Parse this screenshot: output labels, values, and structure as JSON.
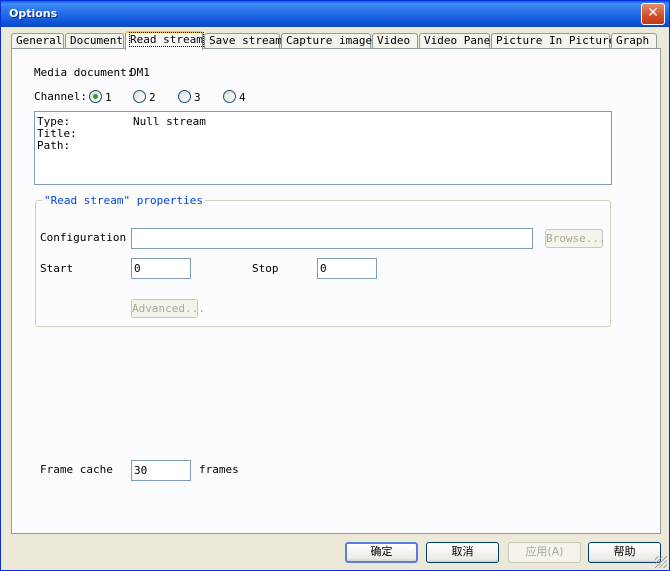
{
  "window": {
    "title": "Options",
    "close_label": "✕"
  },
  "tabs": [
    {
      "label": "General"
    },
    {
      "label": "Document"
    },
    {
      "label": "Read stream",
      "active": true
    },
    {
      "label": "Save stream"
    },
    {
      "label": "Capture image"
    },
    {
      "label": "Video"
    },
    {
      "label": "Video Pane"
    },
    {
      "label": "Picture In Picture"
    },
    {
      "label": "Graph"
    }
  ],
  "media": {
    "label": "Media document:",
    "value": "DM1"
  },
  "channel": {
    "label": "Channel:",
    "options": [
      "1",
      "2",
      "3",
      "4"
    ],
    "selected": "1"
  },
  "info": {
    "type_label": "Type:",
    "type_value": "Null stream",
    "title_label": "Title:",
    "title_value": "",
    "path_label": "Path:",
    "path_value": ""
  },
  "properties": {
    "title": "\"Read stream\" properties",
    "configuration_label": "Configuration",
    "configuration_value": "",
    "browse_label": "Browse...",
    "start_label": "Start",
    "start_value": "0",
    "stop_label": "Stop",
    "stop_value": "0",
    "advanced_label": "Advanced..."
  },
  "cache": {
    "label": "Frame cache",
    "value": "30",
    "unit": "frames"
  },
  "buttons": {
    "ok_label": "确定",
    "cancel_label": "取消",
    "apply_label": "应用(A)",
    "help_label": "帮助"
  },
  "colors": {
    "accent": "#0a5be0",
    "tab_highlight": "#ffc83c",
    "group_title": "#0046d5"
  }
}
